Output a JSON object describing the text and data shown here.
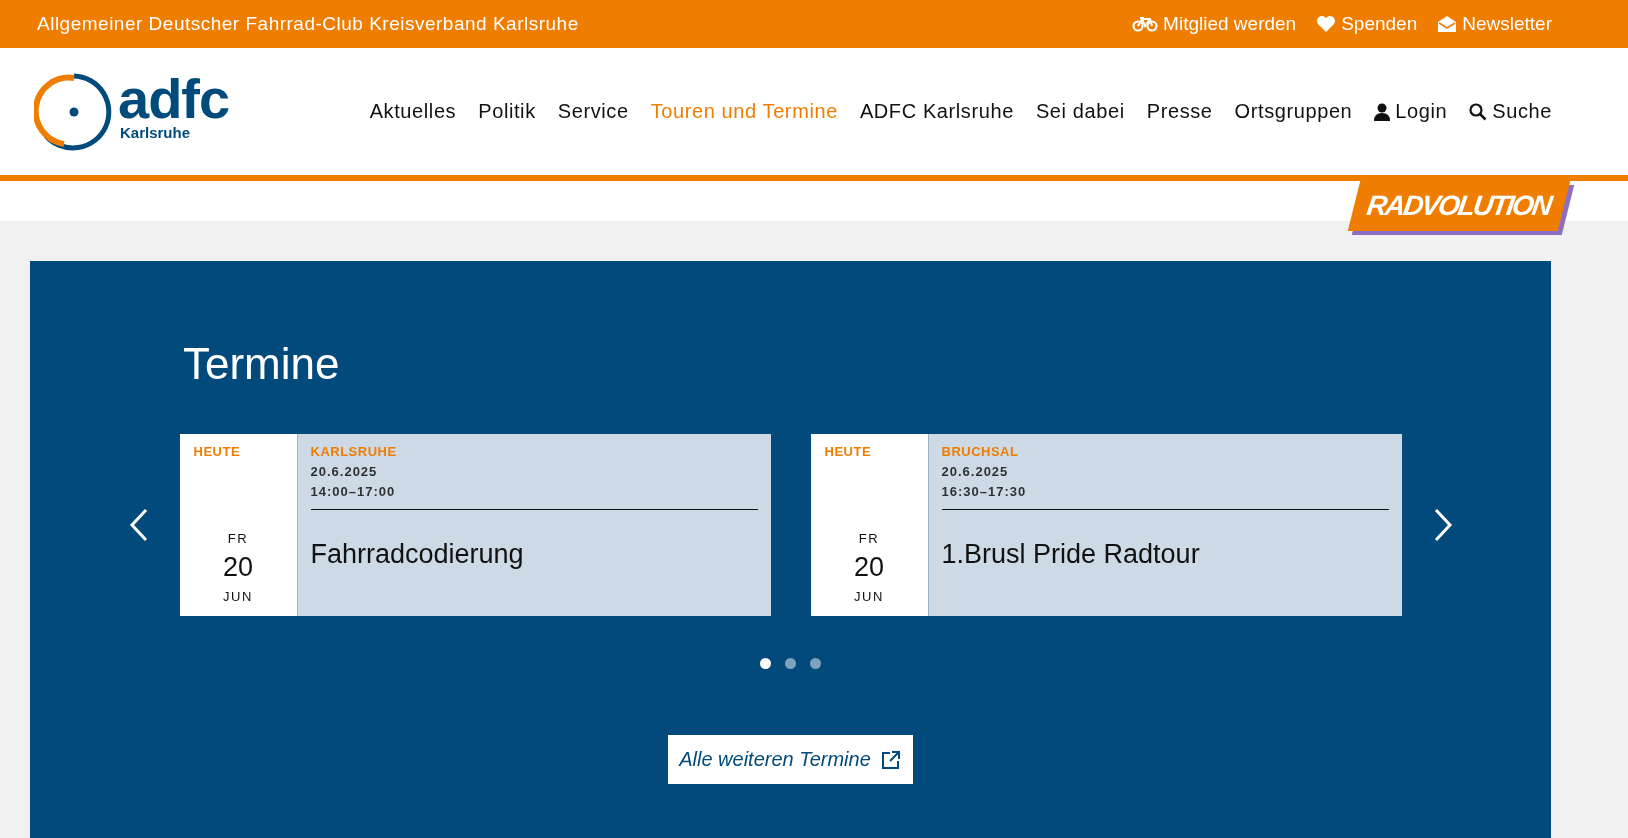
{
  "top_bar": {
    "title": "Allgemeiner Deutscher Fahrrad-Club Kreisverband Karlsruhe",
    "links": [
      {
        "label": "Mitglied werden",
        "kind": "bike"
      },
      {
        "label": "Spenden",
        "kind": "heart"
      },
      {
        "label": "Newsletter",
        "kind": "mail"
      }
    ]
  },
  "logo": {
    "name": "adfc",
    "subtitle": "Karlsruhe"
  },
  "nav": [
    {
      "label": "Aktuelles",
      "selected": false
    },
    {
      "label": "Politik",
      "selected": false
    },
    {
      "label": "Service",
      "selected": false
    },
    {
      "label": "Touren und Termine",
      "selected": true
    },
    {
      "label": "ADFC Karlsruhe",
      "selected": false
    },
    {
      "label": "Sei dabei",
      "selected": false
    },
    {
      "label": "Presse",
      "selected": false
    },
    {
      "label": "Ortsgruppen",
      "selected": false
    },
    {
      "label": "Login",
      "kind": "user",
      "selected": false
    },
    {
      "label": "Suche",
      "kind": "search",
      "selected": false
    }
  ],
  "badge": {
    "text": "RADVOLUTION"
  },
  "events": {
    "title": "Termine",
    "cards": [
      {
        "tag": "HEUTE",
        "weekday": "FR",
        "day": "20",
        "month": "JUN",
        "place": "KARLSRUHE",
        "date": "20.6.2025",
        "time": "14:00–17:00",
        "name": "Fahrradcodierung"
      },
      {
        "tag": "HEUTE",
        "weekday": "FR",
        "day": "20",
        "month": "JUN",
        "place": "BRUCHSAL",
        "date": "20.6.2025",
        "time": "16:30–17:30",
        "name": "1.Brusl Pride Radtour"
      }
    ],
    "dots": [
      {
        "selected": true
      },
      {
        "selected": false
      },
      {
        "selected": false
      }
    ],
    "more_button": "Alle weiteren Termine"
  }
}
